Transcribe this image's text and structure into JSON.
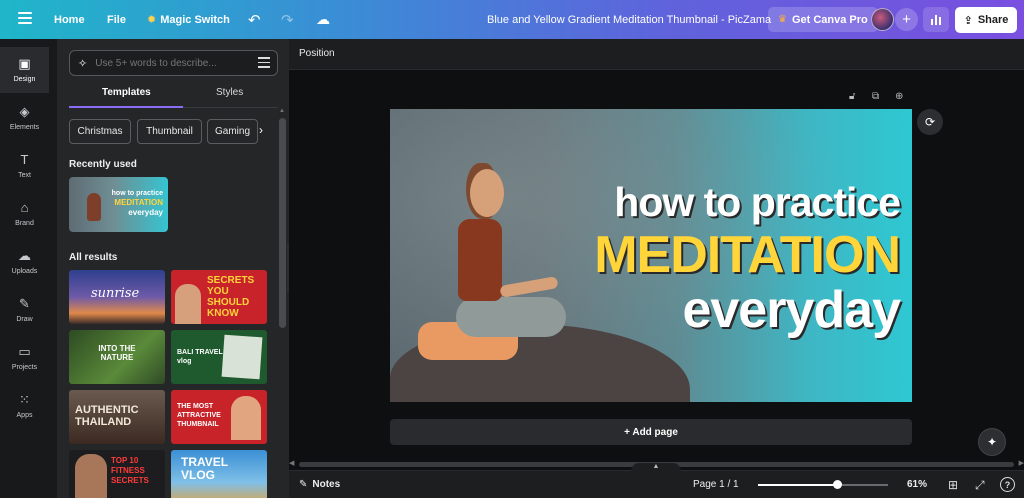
{
  "topbar": {
    "home": "Home",
    "file": "File",
    "magic_switch": "Magic Switch",
    "doc_title": "Blue and Yellow Gradient Meditation Thumbnail - PicZama",
    "get_pro": "Get Canva Pro",
    "share": "Share",
    "icons": [
      "menu-icon",
      "star-icon",
      "undo-icon",
      "redo-icon",
      "cloud-icon",
      "crown-icon",
      "plus-icon",
      "analytics-icon",
      "upload-icon"
    ]
  },
  "rail": [
    {
      "label": "Design",
      "icon": "design-icon"
    },
    {
      "label": "Elements",
      "icon": "elements-icon"
    },
    {
      "label": "Text",
      "icon": "text-icon"
    },
    {
      "label": "Brand",
      "icon": "brand-icon"
    },
    {
      "label": "Uploads",
      "icon": "uploads-icon"
    },
    {
      "label": "Draw",
      "icon": "draw-icon"
    },
    {
      "label": "Projects",
      "icon": "projects-icon"
    },
    {
      "label": "Apps",
      "icon": "apps-icon"
    }
  ],
  "panel": {
    "search_placeholder": "Use 5+ words to describe...",
    "tabs": [
      "Templates",
      "Styles"
    ],
    "chips": [
      "Christmas",
      "Thumbnail",
      "Gaming"
    ],
    "recently_used": "Recently used",
    "recent_thumb": {
      "line1": "how to practice",
      "line2": "MEDITATION",
      "line3": "everyday"
    },
    "all_results": "All results",
    "results": [
      {
        "text": "sunrise"
      },
      {
        "text": "SECRETS YOU SHOULD KNOW"
      },
      {
        "text": "INTO THE NATURE"
      },
      {
        "text": "BALI TRAVEL vlog"
      },
      {
        "text": "AUTHENTIC THAILAND"
      },
      {
        "text": "THE MOST ATTRACTIVE THUMBNAIL"
      },
      {
        "text": "TOP 10 FITNESS SECRETS"
      },
      {
        "text": "TRAVEL VLOG"
      }
    ]
  },
  "editor": {
    "context_label": "Position",
    "canvas": {
      "line1": "how to practice",
      "line2": "MEDITATION",
      "line3": "everyday"
    },
    "add_page": "+ Add page"
  },
  "bottombar": {
    "notes": "Notes",
    "page_indicator": "Page 1 / 1",
    "zoom": "61%",
    "zoom_fraction": 0.61,
    "help": "?"
  },
  "colors": {
    "accent_purple": "#8b6cf4",
    "headline_yellow": "#ffd53a",
    "canvas_teal": "#2ec8d3"
  }
}
